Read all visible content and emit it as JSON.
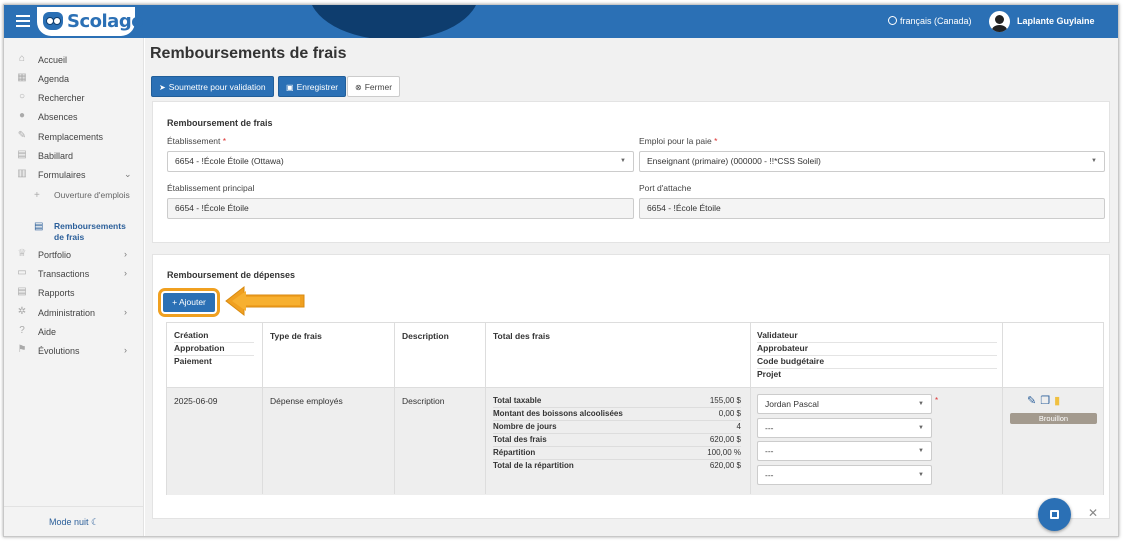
{
  "header": {
    "app_name": "Scolago",
    "language": "français (Canada)",
    "user_name": "Laplante Guylaine"
  },
  "sidebar": {
    "items": [
      {
        "label": "Accueil",
        "icon": "home-icon"
      },
      {
        "label": "Agenda",
        "icon": "calendar-icon"
      },
      {
        "label": "Rechercher",
        "icon": "search-icon"
      },
      {
        "label": "Absences",
        "icon": "user-absence-icon"
      },
      {
        "label": "Remplacements",
        "icon": "replacement-icon"
      },
      {
        "label": "Babillard",
        "icon": "board-icon"
      },
      {
        "label": "Formulaires",
        "icon": "form-icon"
      },
      {
        "label": "Portfolio",
        "icon": "trophy-icon"
      },
      {
        "label": "Transactions",
        "icon": "transactions-icon"
      },
      {
        "label": "Rapports",
        "icon": "report-icon"
      },
      {
        "label": "Administration",
        "icon": "gear-icon"
      },
      {
        "label": "Aide",
        "icon": "help-icon"
      },
      {
        "label": "Évolutions",
        "icon": "evolution-icon"
      }
    ],
    "sub_items": [
      {
        "label": "Ouverture d'emplois",
        "icon": "add-user-icon"
      },
      {
        "label": "Remboursements de frais",
        "icon": "document-icon"
      }
    ],
    "footer": "Mode nuit ☾"
  },
  "page": {
    "title": "Remboursements de frais",
    "buttons": {
      "submit": "Soumettre pour validation",
      "save": "Enregistrer",
      "close": "Fermer"
    }
  },
  "form": {
    "section_title": "Remboursement de frais",
    "etablissement_label": "Établissement",
    "etablissement_value": "6654 - !École Étoile (Ottawa)",
    "emploi_label": "Emploi pour la paie",
    "emploi_value": "Enseignant (primaire) (000000 - !!*CSS Soleil)",
    "etab_principal_label": "Établissement principal",
    "etab_principal_value": "6654 - !École Étoile",
    "port_label": "Port d'attache",
    "port_value": "6654 - !École Étoile",
    "required_mark": "*"
  },
  "expenses": {
    "section_title": "Remboursement de dépenses",
    "add_button": "+ Ajouter",
    "columns": {
      "col1": [
        "Création",
        "Approbation",
        "Paiement"
      ],
      "type": "Type de frais",
      "description": "Description",
      "total": "Total des frais",
      "col5": [
        "Validateur",
        "Approbateur",
        "Code budgétaire",
        "Projet"
      ]
    },
    "row": {
      "date": "2025-06-09",
      "type": "Dépense employés",
      "description": "Description",
      "totals": [
        {
          "label": "Total taxable",
          "value": "155,00 $"
        },
        {
          "label": "Montant des boissons alcoolisées",
          "value": "0,00 $"
        },
        {
          "label": "Nombre de jours",
          "value": "4"
        },
        {
          "label": "Total des frais",
          "value": "620,00 $"
        },
        {
          "label": "Répartition",
          "value": "100,00 %"
        },
        {
          "label": "Total de la répartition",
          "value": "620,00 $"
        }
      ],
      "validateur": "Jordan Pascal",
      "approbateur": "---",
      "code_budgetaire": "---",
      "projet": "---",
      "status": "Brouillon"
    }
  },
  "colors": {
    "primary": "#2b70b5",
    "header_dark": "#0e3d6e",
    "highlight": "#f0a020",
    "status_badge": "#a39a8e"
  }
}
